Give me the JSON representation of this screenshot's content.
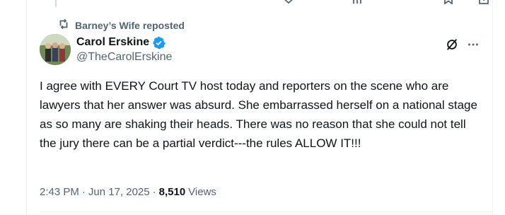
{
  "repost": {
    "label": "Barney’s Wife reposted"
  },
  "tweet": {
    "author_name": "Carol Erskine",
    "author_handle": "@TheCarolErskine",
    "verified": true,
    "text": "I agree with EVERY Court TV host today and reporters on the scene who are lawyers that her answer was absurd. She embarrassed herself on a national stage as so many are shaking their heads. There was no reason that she could not tell the jury there can be a partial verdict---the rules ALLOW IT!!!",
    "time": "2:43 PM",
    "separator": "·",
    "date": "Jun 17, 2025",
    "views_count": "8,510",
    "views_label": "Views"
  },
  "icons": {
    "repost": "repost-icon",
    "verified": "verified-badge-icon",
    "grok": "grok-icon",
    "more": "more-icon"
  },
  "colors": {
    "text_primary": "#0f1419",
    "text_secondary": "#536471",
    "verified_blue": "#1d9bf0",
    "divider": "#eff3f4"
  }
}
